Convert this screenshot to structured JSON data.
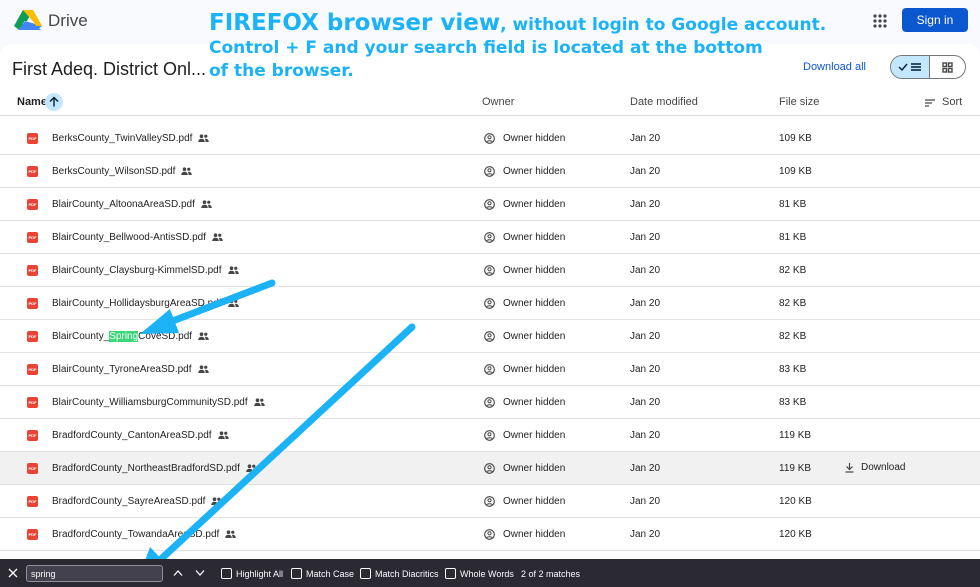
{
  "topbar": {
    "brand": "Drive",
    "signin_label": "Sign in"
  },
  "folder": {
    "title": "First Adeq. District Onl...",
    "download_all": "Download all"
  },
  "columns": {
    "name": "Name",
    "owner": "Owner",
    "date": "Date modified",
    "size": "File size",
    "sort": "Sort"
  },
  "files": [
    {
      "name": "BerksCounty_TwinValleySD.pdf",
      "owner": "Owner hidden",
      "date": "Jan 20",
      "size": "109 KB"
    },
    {
      "name": "BerksCounty_WilsonSD.pdf",
      "owner": "Owner hidden",
      "date": "Jan 20",
      "size": "109 KB"
    },
    {
      "name": "BlairCounty_AltoonaAreaSD.pdf",
      "owner": "Owner hidden",
      "date": "Jan 20",
      "size": "81 KB"
    },
    {
      "name": "BlairCounty_Bellwood-AntisSD.pdf",
      "owner": "Owner hidden",
      "date": "Jan 20",
      "size": "81 KB"
    },
    {
      "name": "BlairCounty_Claysburg-KimmelSD.pdf",
      "owner": "Owner hidden",
      "date": "Jan 20",
      "size": "82 KB"
    },
    {
      "name": "BlairCounty_HollidaysburgAreaSD.pdf",
      "owner": "Owner hidden",
      "date": "Jan 20",
      "size": "82 KB"
    },
    {
      "name": "BlairCounty_SpringCoveSD.pdf",
      "name_pre": "BlairCounty_",
      "name_match": "Spring",
      "name_post": "CoveSD.pdf",
      "owner": "Owner hidden",
      "date": "Jan 20",
      "size": "82 KB"
    },
    {
      "name": "BlairCounty_TyroneAreaSD.pdf",
      "owner": "Owner hidden",
      "date": "Jan 20",
      "size": "83 KB"
    },
    {
      "name": "BlairCounty_WilliamsburgCommunitySD.pdf",
      "owner": "Owner hidden",
      "date": "Jan 20",
      "size": "83 KB"
    },
    {
      "name": "BradfordCounty_CantonAreaSD.pdf",
      "owner": "Owner hidden",
      "date": "Jan 20",
      "size": "119 KB"
    },
    {
      "name": "BradfordCounty_NortheastBradfordSD.pdf",
      "owner": "Owner hidden",
      "date": "Jan 20",
      "size": "119 KB",
      "action": "Download"
    },
    {
      "name": "BradfordCounty_SayreAreaSD.pdf",
      "owner": "Owner hidden",
      "date": "Jan 20",
      "size": "120 KB"
    },
    {
      "name": "BradfordCounty_TowandaAreaSD.pdf",
      "owner": "Owner hidden",
      "date": "Jan 20",
      "size": "120 KB"
    }
  ],
  "icons": {
    "file": "pdf-icon",
    "shared": "people-icon",
    "owner": "account-circle-icon",
    "download": "download-icon"
  },
  "colors": {
    "brand_blue": "#0b57d0",
    "selected_toggle": "#c2e7ff",
    "pdf_red": "#ea4335",
    "annotation": "#1bb3f5",
    "match_highlight": "#38d878",
    "findbar_bg": "#2b2a33"
  },
  "annotation": {
    "line1_bold": "FIREFOX browser view",
    "line1_rest": ", without login to Google account.",
    "line2": "Control + F and your search field is located at the bottom",
    "line3": "of the browser."
  },
  "findbar": {
    "query": "spring",
    "highlight_all": "Highlight All",
    "match_case": "Match Case",
    "match_diacritics": "Match Diacritics",
    "whole_words": "Whole Words",
    "status": "2 of 2 matches"
  }
}
